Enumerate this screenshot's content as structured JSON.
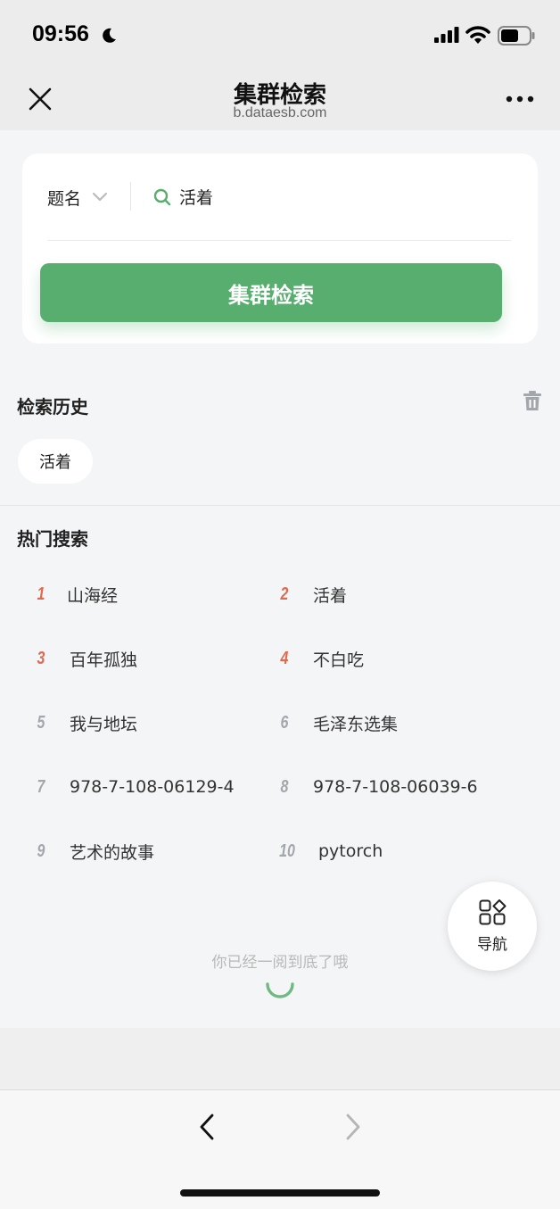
{
  "status_bar": {
    "time": "09:56"
  },
  "header": {
    "title": "集群检索",
    "subtitle": "b.dataesb.com"
  },
  "search": {
    "field_label": "题名",
    "query": "活着",
    "button_label": "集群检索"
  },
  "history": {
    "title": "检索历史",
    "items": [
      "活着"
    ]
  },
  "hot": {
    "title": "热门搜索",
    "items": [
      {
        "rank": "1",
        "text": "山海经"
      },
      {
        "rank": "2",
        "text": "活着"
      },
      {
        "rank": "3",
        "text": "百年孤独"
      },
      {
        "rank": "4",
        "text": "不白吃"
      },
      {
        "rank": "5",
        "text": "我与地坛"
      },
      {
        "rank": "6",
        "text": "毛泽东选集"
      },
      {
        "rank": "7",
        "text": "978-7-108-06129-4"
      },
      {
        "rank": "8",
        "text": "978-7-108-06039-6"
      },
      {
        "rank": "9",
        "text": "艺术的故事"
      },
      {
        "rank": "10",
        "text": "pytorch"
      }
    ]
  },
  "end_message": "你已经一阅到底了哦",
  "fab": {
    "label": "导航"
  },
  "colors": {
    "accent": "#57ae6e",
    "rank_top": "#e06a4e",
    "rank_normal": "#a3a7ad"
  },
  "icons": [
    "moon-icon",
    "signal-icon",
    "wifi-icon",
    "battery-icon",
    "close-icon",
    "more-icon",
    "chevron-down-icon",
    "search-icon",
    "trash-icon",
    "grid-icon",
    "back-arrow-icon",
    "forward-arrow-icon"
  ]
}
